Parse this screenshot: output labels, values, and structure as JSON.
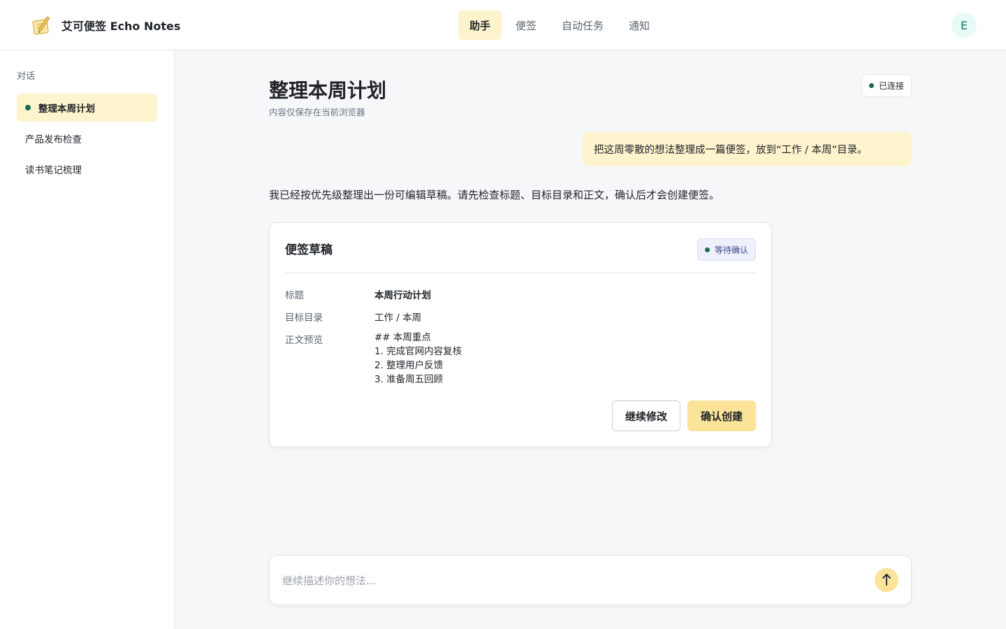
{
  "header": {
    "brand_name": "艾可便签 Echo Notes",
    "tabs": [
      {
        "label": "助手",
        "active": true
      },
      {
        "label": "便签",
        "active": false
      },
      {
        "label": "自动任务",
        "active": false
      },
      {
        "label": "通知",
        "active": false
      }
    ],
    "avatar_initial": "E"
  },
  "sidebar": {
    "heading": "对话",
    "conversations": [
      {
        "label": "整理本周计划",
        "active": true
      },
      {
        "label": "产品发布检查",
        "active": false
      },
      {
        "label": "读书笔记梳理",
        "active": false
      }
    ]
  },
  "main": {
    "title": "整理本周计划",
    "subtitle": "内容仅保存在当前浏览器",
    "connection_status": "已连接",
    "user_message": "把这周零散的想法整理成一篇便签，放到“工作 / 本周”目录。",
    "assistant_message": "我已经按优先级整理出一份可编辑草稿。请先检查标题、目标目录和正文，确认后才会创建便签。",
    "draft": {
      "card_title": "便签草稿",
      "status": "等待确认",
      "fields": {
        "title_label": "标题",
        "title_value": "本周行动计划",
        "folder_label": "目标目录",
        "folder_value": "工作 / 本周",
        "body_label": "正文预览",
        "body_lines": [
          "## 本周重点",
          "1. 完成官网内容复核",
          "2. 整理用户反馈",
          "3. 准备周五回顾"
        ]
      },
      "secondary_button": "继续修改",
      "primary_button": "确认创建"
    },
    "composer": {
      "placeholder": "继续描述你的想法…",
      "value": ""
    }
  },
  "colors": {
    "accent": "#fbe39a",
    "active_bg": "#fdf3cc",
    "status_dot": "#1a6b4f",
    "avatar_bg": "#e7faf6",
    "avatar_text": "#0f7a66"
  },
  "icons": {
    "brand": "notepad-pencil-icon",
    "status_dot": "dot-icon",
    "send": "arrow-up-icon"
  }
}
